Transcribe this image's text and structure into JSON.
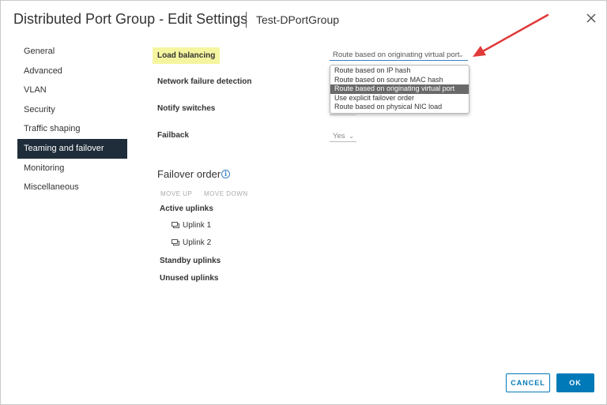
{
  "header": {
    "title": "Distributed Port Group - Edit Settings",
    "subtitle": "Test-DPortGroup",
    "close_icon": "close-icon"
  },
  "nav": {
    "items": [
      {
        "label": "General"
      },
      {
        "label": "Advanced"
      },
      {
        "label": "VLAN"
      },
      {
        "label": "Security"
      },
      {
        "label": "Traffic shaping"
      },
      {
        "label": "Teaming and failover",
        "active": true
      },
      {
        "label": "Monitoring"
      },
      {
        "label": "Miscellaneous"
      }
    ]
  },
  "form": {
    "load_balancing_label": "Load balancing",
    "load_balancing_value": "Route based on originating virtual port",
    "load_balancing_options": [
      "Route based on IP hash",
      "Route based on source MAC hash",
      "Route based on originating virtual port",
      "Use explicit failover order",
      "Route based on physical NIC load"
    ],
    "selected_option_index": 2,
    "network_failure_label": "Network failure detection",
    "notify_switches_label": "Notify switches",
    "failback_label": "Failback",
    "failback_value": "Yes"
  },
  "failover_order": {
    "title": "Failover order",
    "move_up": "MOVE UP",
    "move_down": "MOVE DOWN",
    "active_uplinks_label": "Active uplinks",
    "active_uplinks": [
      "Uplink 1",
      "Uplink 2"
    ],
    "standby_uplinks_label": "Standby uplinks",
    "unused_uplinks_label": "Unused uplinks"
  },
  "footer": {
    "cancel_label": "CANCEL",
    "ok_label": "OK"
  },
  "colors": {
    "accent": "#0079b8",
    "nav_active_bg": "#1f2d3a",
    "highlight": "#f5f5a0",
    "annotation_arrow": "#e03a3a"
  }
}
